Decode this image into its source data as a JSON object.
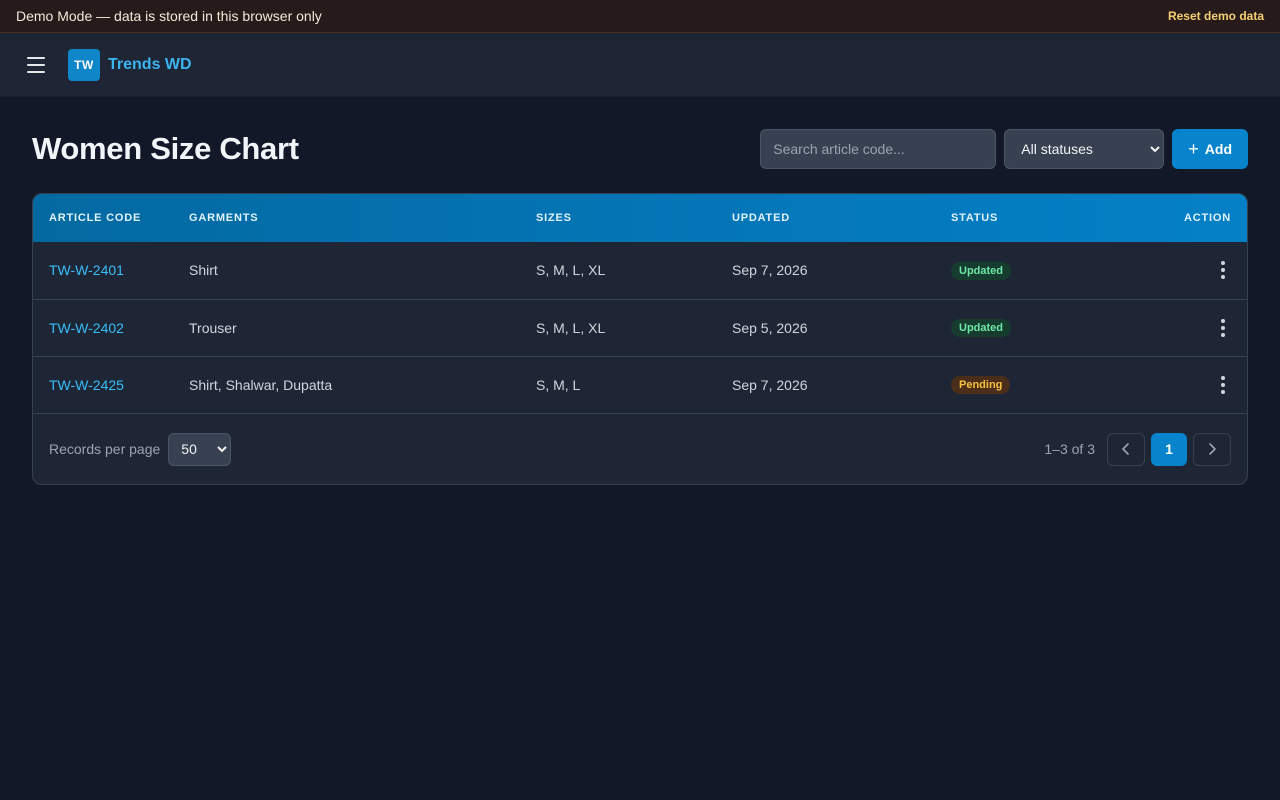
{
  "banner": {
    "text": "Demo Mode — data is stored in this browser only",
    "reset_label": "Reset demo data"
  },
  "topbar": {
    "menu_icon": "hamburger-menu-icon",
    "logo_text": "TW",
    "brand_name": "Trends WD"
  },
  "page": {
    "title": "Women Size Chart"
  },
  "controls": {
    "search_placeholder": "Search article code...",
    "status_selected": "All statuses",
    "add_label": "Add",
    "add_icon": "plus-icon"
  },
  "table": {
    "columns": [
      "Article Code",
      "Garments",
      "Sizes",
      "Updated",
      "Status",
      "Action"
    ],
    "rows": [
      {
        "code": "TW-W-2401",
        "garments": "Shirt",
        "sizes": "S, M, L, XL",
        "updated": "Sep 7, 2026",
        "status": "Updated"
      },
      {
        "code": "TW-W-2402",
        "garments": "Trouser",
        "sizes": "S, M, L, XL",
        "updated": "Sep 5, 2026",
        "status": "Updated"
      },
      {
        "code": "TW-W-2425",
        "garments": "Shirt, Shalwar, Dupatta",
        "sizes": "S, M, L",
        "updated": "Sep 7, 2026",
        "status": "Pending"
      }
    ]
  },
  "footer": {
    "records_label": "Records per page",
    "records_value": "50",
    "range_text": "1–3 of 3",
    "current_page": "1",
    "prev_icon": "chevron-left-icon",
    "next_icon": "chevron-right-icon"
  },
  "colors": {
    "accent": "#0784cb",
    "link": "#38bdf8",
    "updated_badge": "#6ee7a8",
    "pending_badge": "#fbbf40",
    "banner_bg": "#261a1a"
  }
}
